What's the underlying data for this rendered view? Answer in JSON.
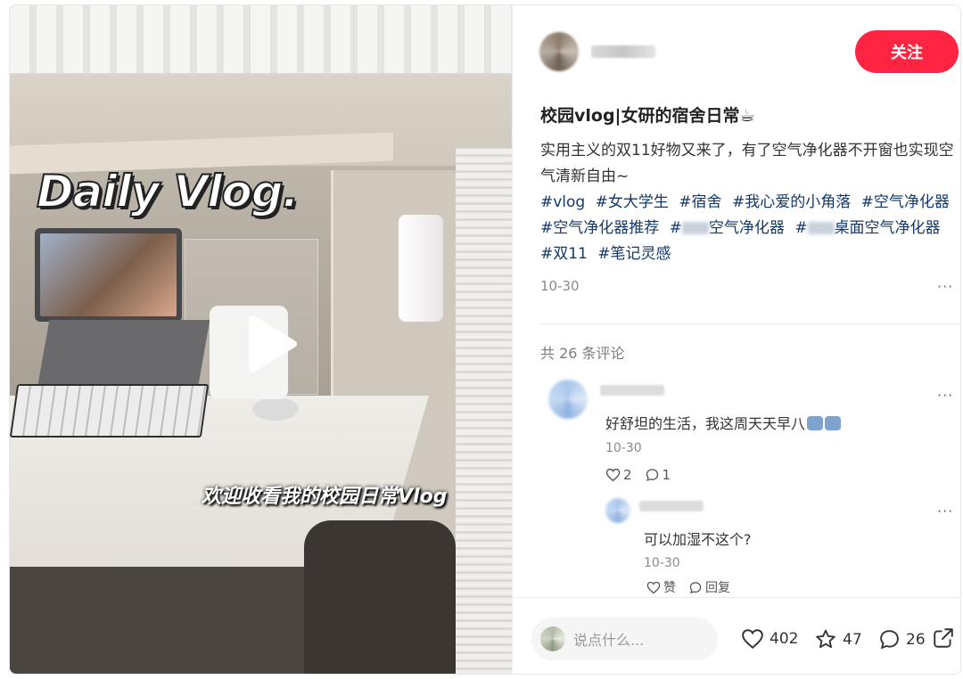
{
  "media": {
    "overlay_title": "Daily Vlog.",
    "caption": "欢迎收看我的校园日常Vlog",
    "play_icon": "play-icon"
  },
  "header": {
    "follow_label": "关注"
  },
  "post": {
    "title": "校园vlog|女研的宿舍日常☕",
    "description": "实用主义的双11好物又来了，有了空气净化器不开窗也实现空气清新自由~",
    "tags": [
      "#vlog",
      "#女大学生",
      "#宿舍",
      "#我心爱的小角落",
      "#空气净化器",
      "#空气净化器推荐",
      "空气净化器",
      "桌面空气净化器",
      "#双11",
      "#笔记灵感"
    ],
    "date": "10-30"
  },
  "comments": {
    "count_label": "共 26 条评论",
    "items": [
      {
        "text": "好舒坦的生活，我这周天天早八",
        "date": "10-30",
        "likes": "2",
        "replies": "1"
      }
    ],
    "reply": {
      "text": "可以加湿不这个?",
      "date": "10-30",
      "like_label": "赞",
      "reply_label": "回复"
    }
  },
  "bottom_bar": {
    "placeholder": "说点什么...",
    "likes": "402",
    "stars": "47",
    "comments": "26"
  },
  "colors": {
    "accent": "#ff2442",
    "tag": "#13386c"
  }
}
